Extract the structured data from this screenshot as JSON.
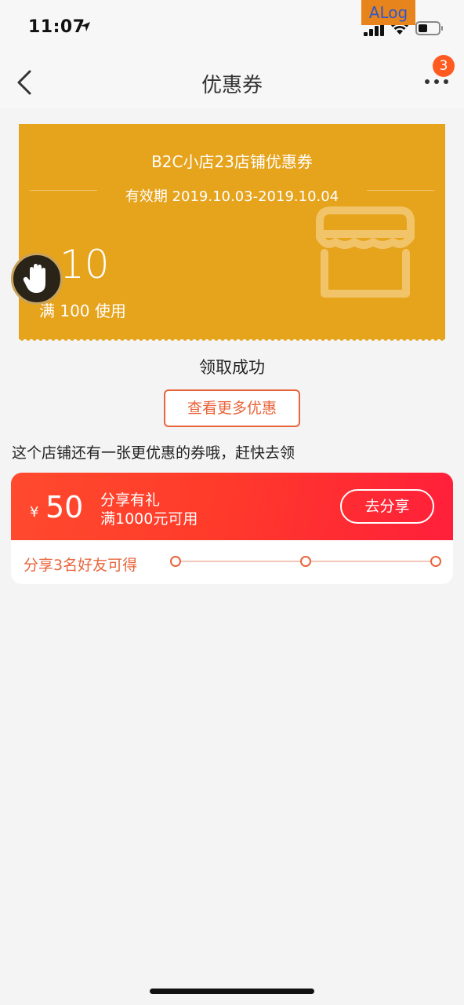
{
  "status_bar": {
    "time": "11:07",
    "debug_tag": "ALog"
  },
  "nav": {
    "title": "优惠券",
    "badge_count": "3"
  },
  "coupon": {
    "title": "B2C小店23店铺优惠券",
    "validity": "有效期 2019.10.03-2019.10.04",
    "currency": "¥",
    "amount": "10",
    "condition": "满 100 使用",
    "icon": "store-icon",
    "color": "#e6a31c"
  },
  "result": {
    "message": "领取成功",
    "more_label": "查看更多优惠"
  },
  "hint": "这个店铺还有一张更优惠的券哦，赶快去领",
  "share_coupon": {
    "currency": "¥",
    "amount": "50",
    "name": "分享有礼",
    "condition": "满1000元可用",
    "button_label": "去分享",
    "friends_label": "分享3名好友可得",
    "progress": {
      "completed": 0,
      "total": 3
    },
    "color": "#ff3b2a"
  },
  "accent_color": "#e8643a"
}
